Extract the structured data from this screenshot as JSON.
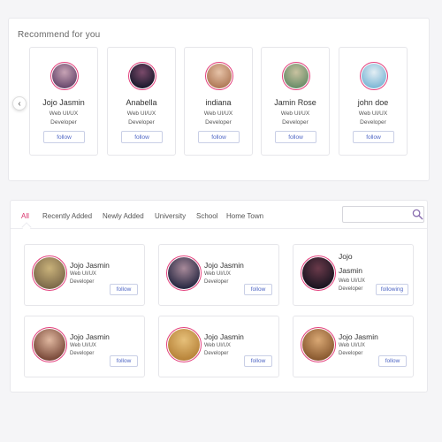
{
  "recommend": {
    "title": "Recommend for you",
    "cards": [
      {
        "name": "Jojo Jasmin",
        "role_line1": "Web UI/UX",
        "role_line2": "Developer",
        "button": "follow",
        "colors": [
          "#6a4a6e",
          "#c7a3b5"
        ]
      },
      {
        "name": "Anabella",
        "role_line1": "Web UI/UX",
        "role_line2": "Developer",
        "button": "follow",
        "colors": [
          "#1d1a2e",
          "#7a4a6a"
        ]
      },
      {
        "name": "indiana",
        "role_line1": "Web UI/UX",
        "role_line2": "Developer",
        "button": "follow",
        "colors": [
          "#b07a58",
          "#e6c3a8"
        ]
      },
      {
        "name": "Jamin Rose",
        "role_line1": "Web UI/UX",
        "role_line2": "Developer",
        "button": "follow",
        "colors": [
          "#6b8e6a",
          "#c9c2a0"
        ]
      },
      {
        "name": "john doe",
        "role_line1": "Web UI/UX",
        "role_line2": "Developer",
        "button": "follow",
        "colors": [
          "#7fb8d6",
          "#e3eef4"
        ]
      }
    ]
  },
  "friends": {
    "tabs": [
      "All",
      "Recently Added",
      "Newly Added",
      "University",
      "School",
      "Home Town"
    ],
    "active_tab": "All",
    "search": {
      "placeholder": "",
      "value": ""
    },
    "cards": [
      {
        "name": "Jojo Jasmin",
        "role_line1": "Web UI/UX",
        "role_line2": "Developer",
        "button": "follow",
        "colors": [
          "#7d6a4a",
          "#c9b27a"
        ]
      },
      {
        "name": "Jojo Jasmin",
        "role_line1": "Web UI/UX",
        "role_line2": "Developer",
        "button": "follow",
        "colors": [
          "#2a2a44",
          "#a88a9a"
        ]
      },
      {
        "name": "Jojo Jasmin",
        "role_line1": "Web UI/UX",
        "role_line2": "Developer",
        "button": "following",
        "colors": [
          "#1a1420",
          "#6a3a4a"
        ]
      },
      {
        "name": "Jojo Jasmin",
        "role_line1": "Web UI/UX",
        "role_line2": "Developer",
        "button": "follow",
        "colors": [
          "#7a4a3a",
          "#e0b8a0"
        ]
      },
      {
        "name": "Jojo Jasmin",
        "role_line1": "Web UI/UX",
        "role_line2": "Developer",
        "button": "follow",
        "colors": [
          "#b8843a",
          "#e6c07a"
        ]
      },
      {
        "name": "Jojo Jasmin",
        "role_line1": "Web UI/UX",
        "role_line2": "Developer",
        "button": "follow",
        "colors": [
          "#8a5a30",
          "#d9a874"
        ]
      }
    ]
  },
  "icons": {
    "scroll_left": "chevron-left-icon",
    "search": "search-icon"
  },
  "colors": {
    "accent": "#d9336b",
    "avatar_ring": "#e3417d",
    "button_text": "#4c64c4",
    "button_border": "#c9cfe6"
  }
}
